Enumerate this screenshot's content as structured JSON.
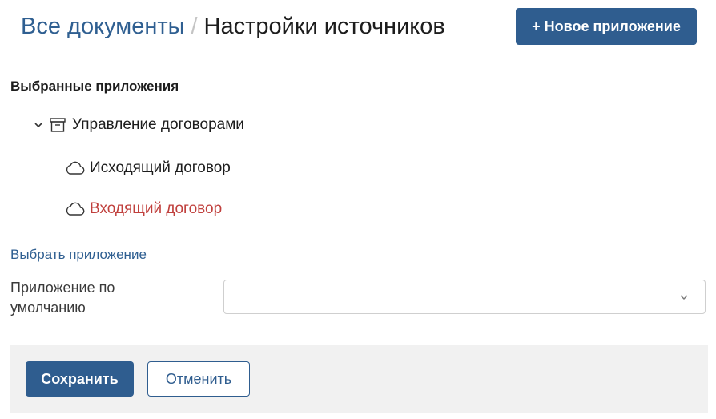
{
  "header": {
    "breadcrumb_parent": "Все документы",
    "breadcrumb_separator": "/",
    "breadcrumb_current": "Настройки источников",
    "new_app_button": "+ Новое приложение"
  },
  "selected_apps": {
    "title": "Выбранные приложения",
    "group": {
      "label": "Управление договорами",
      "icon": "archive-box-icon",
      "expanded": true,
      "items": [
        {
          "label": "Исходящий договор",
          "icon": "cloud-icon",
          "color": "#1d1d1d"
        },
        {
          "label": "Входящий договор",
          "icon": "cloud-icon",
          "color": "#c0403d"
        }
      ]
    }
  },
  "choose_app_link": "Выбрать приложение",
  "default_app": {
    "label": "Приложение по умолчанию",
    "value": ""
  },
  "footer": {
    "save_button": "Сохранить",
    "cancel_button": "Отменить"
  },
  "colors": {
    "primary": "#2f5d8f",
    "link": "#2f5f91",
    "danger_text": "#c0403d",
    "footer_bg": "#f1f1f1"
  }
}
